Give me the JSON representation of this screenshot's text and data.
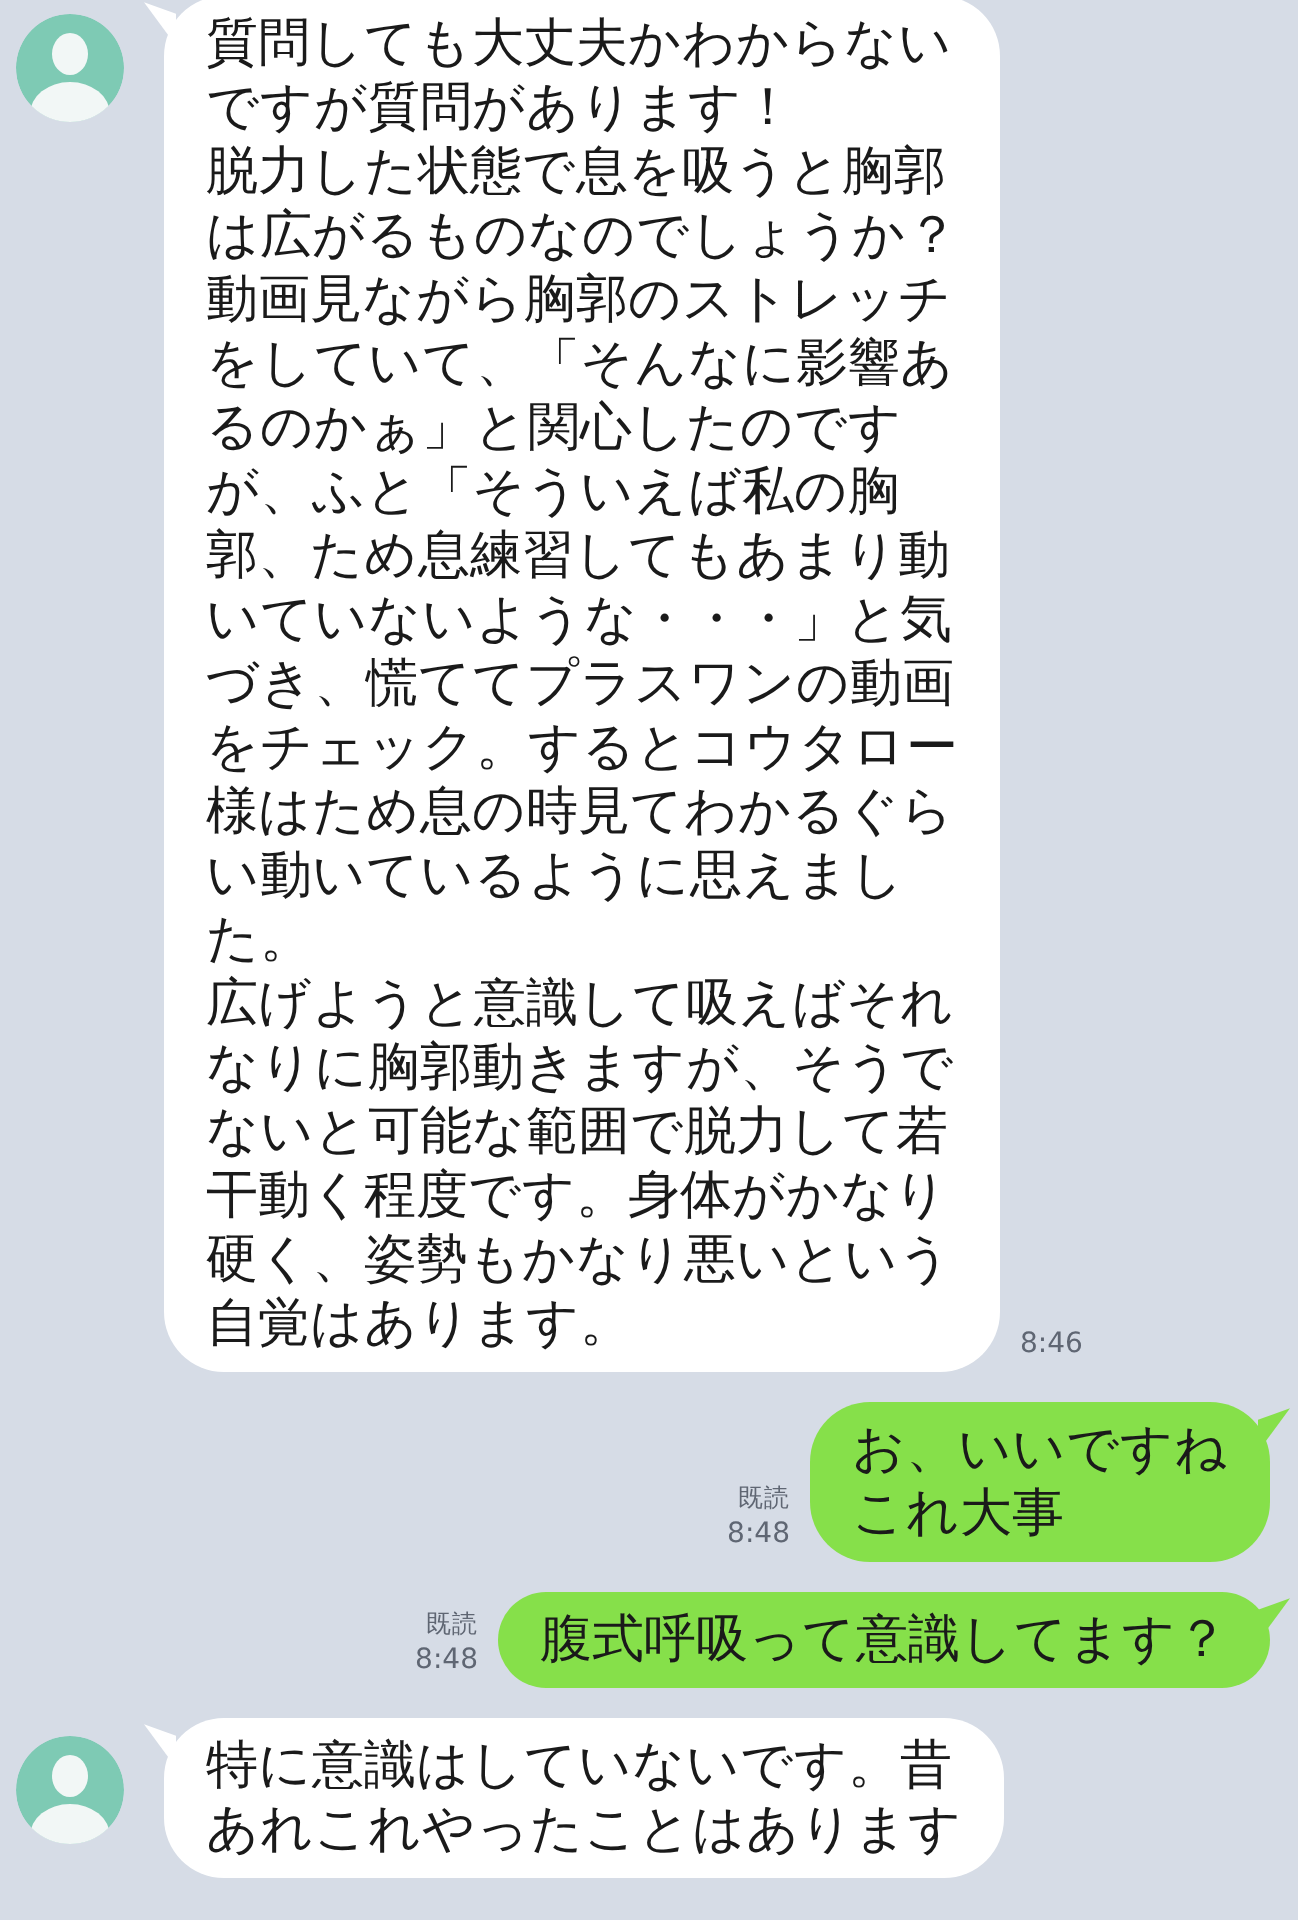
{
  "messages": [
    {
      "kind": "received",
      "lines": [
        "質問しても大丈夫かわからない",
        "ですが質問があります！",
        "脱力した状態で息を吸うと胸郭",
        "は広がるものなのでしょうか？",
        "動画見ながら胸郭のストレッチ",
        "をしていて、「そんなに影響あ",
        "るのかぁ」と関心したのです",
        "が、ふと「そういえば私の胸",
        "郭、ため息練習してもあまり動",
        "いていないような・・・」と気",
        "づき、慌ててプラスワンの動画",
        "をチェック。するとコウタロー",
        "様はため息の時見てわかるぐら",
        "い動いているように思えまし",
        "た。",
        "広げようと意識して吸えばそれ",
        "なりに胸郭動きますが、そうで",
        "ないと可能な範囲で脱力して若",
        "干動く程度です。身体がかなり",
        "硬く、姿勢もかなり悪いという",
        "自覚はあります。"
      ],
      "time": "8:46"
    },
    {
      "kind": "sent",
      "lines": [
        "お、いいですね",
        "これ大事"
      ],
      "read": "既読",
      "time": "8:48"
    },
    {
      "kind": "sent",
      "lines": [
        "腹式呼吸って意識してます？"
      ],
      "read": "既読",
      "time": "8:48"
    },
    {
      "kind": "received",
      "lines": [
        "特に意識はしていないです。昔",
        "あれこれやったことはあります"
      ]
    }
  ]
}
